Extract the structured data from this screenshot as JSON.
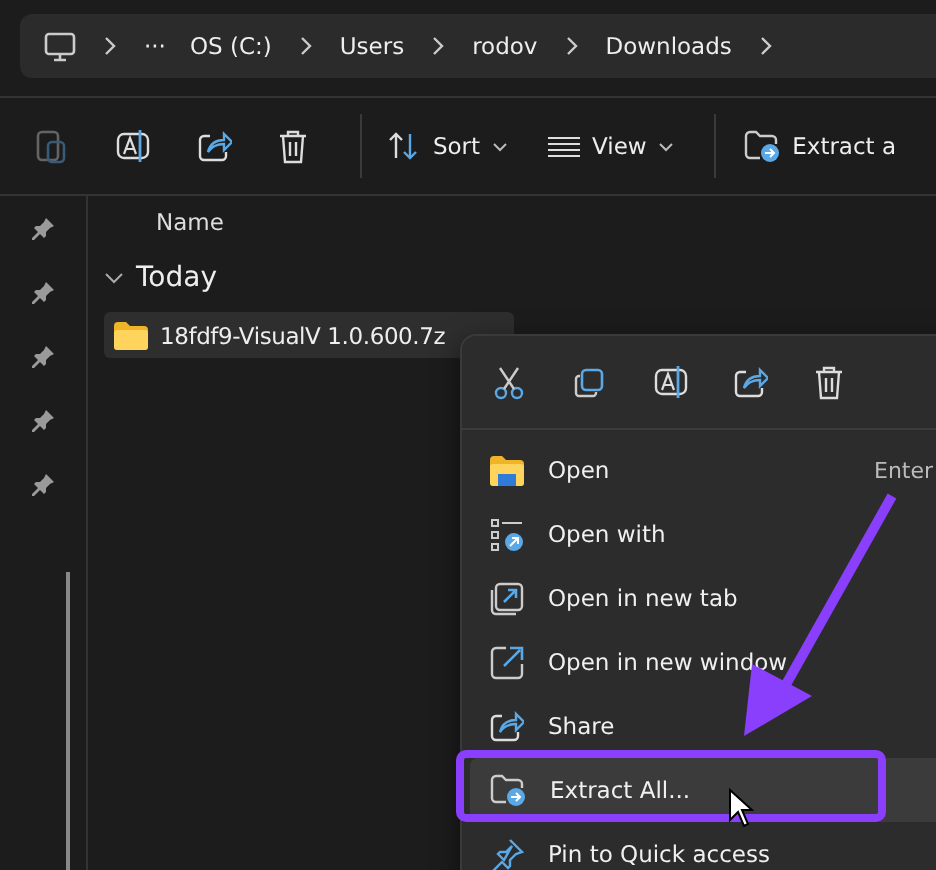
{
  "breadcrumb": {
    "overflow": "···",
    "segments": [
      "OS (C:)",
      "Users",
      "rodov",
      "Downloads"
    ]
  },
  "toolbar": {
    "buttons": [
      {
        "kind": "paste",
        "disabled": true
      },
      {
        "kind": "rename",
        "disabled": false
      },
      {
        "kind": "share",
        "disabled": false
      },
      {
        "kind": "delete",
        "disabled": false
      }
    ],
    "sort": "Sort",
    "view": "View",
    "extract": "Extract a"
  },
  "list": {
    "column": "Name",
    "group": "Today",
    "files": [
      {
        "name": "18fdf9-VisualV 1.0.600.7z",
        "selected": true
      }
    ]
  },
  "context_menu": {
    "items": [
      {
        "kind": "open",
        "label": "Open",
        "shortcut": "Enter",
        "selected": false
      },
      {
        "kind": "open-with",
        "label": "Open with",
        "selected": false
      },
      {
        "kind": "new-tab",
        "label": "Open in new tab",
        "selected": false
      },
      {
        "kind": "new-window",
        "label": "Open in new window",
        "selected": false
      },
      {
        "kind": "share",
        "label": "Share",
        "selected": false
      },
      {
        "kind": "extract",
        "label": "Extract All...",
        "selected": true
      },
      {
        "kind": "pin",
        "label": "Pin to Quick access",
        "selected": false
      }
    ]
  }
}
